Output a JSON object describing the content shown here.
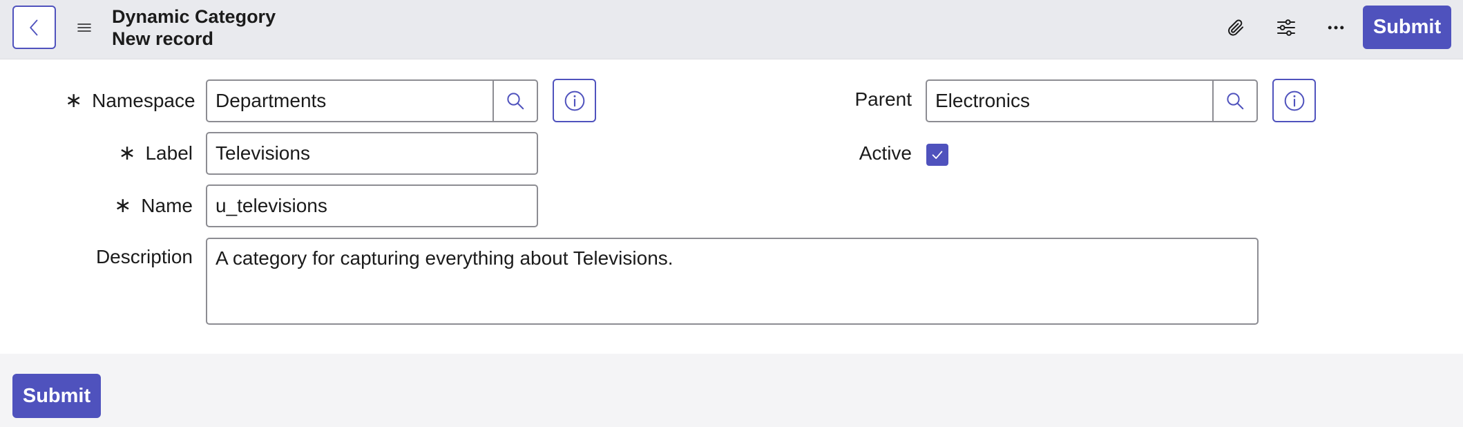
{
  "header": {
    "title": "Dynamic Category",
    "subtitle": "New record",
    "submit_label": "Submit",
    "icons": [
      "chevron-left-icon",
      "hamburger-menu-icon",
      "paperclip-icon",
      "sliders-icon",
      "more-horizontal-icon"
    ]
  },
  "form": {
    "namespace": {
      "label": "Namespace",
      "value": "Departments",
      "required": true
    },
    "label_field": {
      "label": "Label",
      "value": "Televisions",
      "required": true
    },
    "name": {
      "label": "Name",
      "value": "u_televisions",
      "required": true
    },
    "description": {
      "label": "Description",
      "value": "A category for capturing everything about Televisions."
    },
    "parent": {
      "label": "Parent",
      "value": "Electronics"
    },
    "active": {
      "label": "Active",
      "checked": true
    },
    "required_marker": "∗"
  },
  "footer": {
    "submit_label": "Submit"
  },
  "colors": {
    "accent": "#4f52bd",
    "header_bg": "#e9eaee",
    "footer_bg": "#f4f4f6",
    "border": "#8c8c92"
  }
}
